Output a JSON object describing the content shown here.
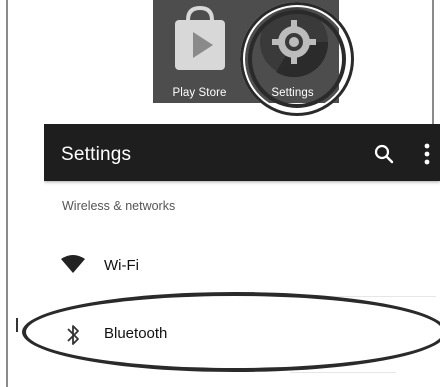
{
  "home_apps": [
    {
      "label": "Play Store",
      "icon": "play-store-icon"
    },
    {
      "label": "Settings",
      "icon": "settings-gear-icon"
    }
  ],
  "appbar": {
    "title": "Settings",
    "search_icon": "search-icon",
    "more_icon": "more-vert-icon"
  },
  "section": {
    "header": "Wireless & networks",
    "items": [
      {
        "label": "Wi-Fi",
        "icon": "wifi-icon"
      },
      {
        "label": "Bluetooth",
        "icon": "bluetooth-icon"
      }
    ]
  },
  "colors": {
    "appbar_bg": "#1e1e1e",
    "tile_bg": "#4d4d4d",
    "highlight": "#2a2a2a"
  }
}
